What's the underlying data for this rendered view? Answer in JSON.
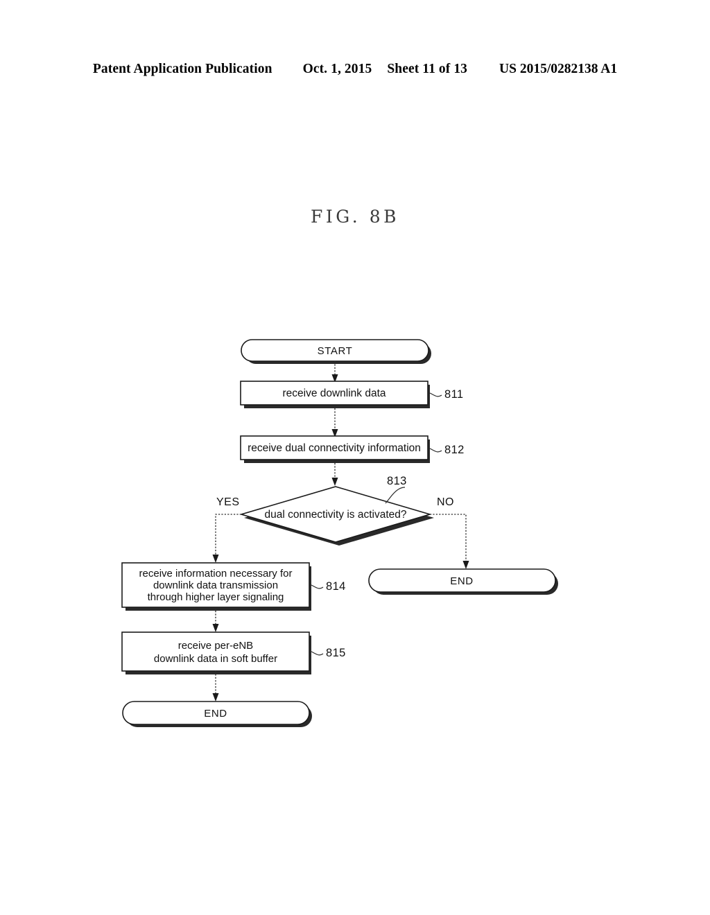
{
  "header": {
    "publication": "Patent Application Publication",
    "date": "Oct. 1, 2015",
    "sheet": "Sheet 11 of 13",
    "patent_number": "US 2015/0282138 A1"
  },
  "figure": {
    "title": "FIG. 8B"
  },
  "flowchart": {
    "start": {
      "label": "START"
    },
    "steps": [
      {
        "ref": "811",
        "label": "receive downlink data"
      },
      {
        "ref": "812",
        "label": "receive dual connectivity information"
      }
    ],
    "decision": {
      "ref": "813",
      "label": "dual connectivity is activated?",
      "yes_label": "YES",
      "no_label": "NO"
    },
    "yes_branch": [
      {
        "ref": "814",
        "lines": [
          "receive information necessary for",
          "downlink data transmission",
          "through higher layer signaling"
        ]
      },
      {
        "ref": "815",
        "lines": [
          "receive per-eNB",
          "downlink data in soft buffer"
        ]
      }
    ],
    "end_yes": {
      "label": "END"
    },
    "end_no": {
      "label": "END"
    }
  }
}
